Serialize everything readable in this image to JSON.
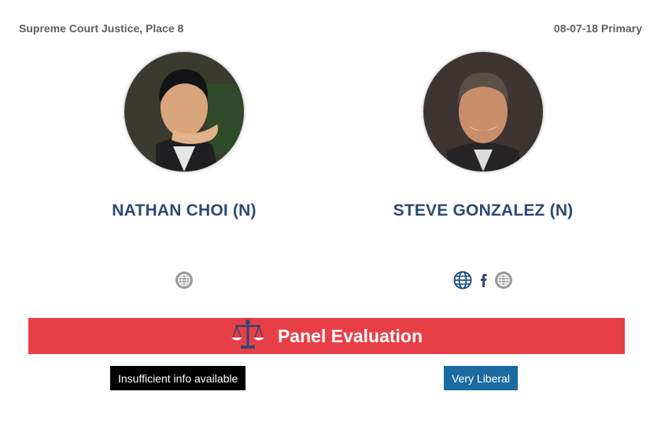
{
  "race": {
    "office": "Supreme Court Justice, Place 8",
    "election": "08-07-18 Primary"
  },
  "candidates": [
    {
      "name": "NATHAN CHOI (N)",
      "links": [
        "website-icon"
      ],
      "evaluation": "Insufficient info available"
    },
    {
      "name": "STEVE GONZALEZ (N)",
      "links": [
        "globe-icon",
        "facebook-icon",
        "website-icon"
      ],
      "evaluation": "Very Liberal"
    }
  ],
  "banner": {
    "title": "Panel Evaluation",
    "icon": "scales-of-justice-icon"
  },
  "colors": {
    "banner": "#e83e45",
    "name": "#2e4a74",
    "insufficient_badge": "#000000",
    "liberal_badge": "#1a6b9f",
    "header_text": "#5f5f5f"
  }
}
